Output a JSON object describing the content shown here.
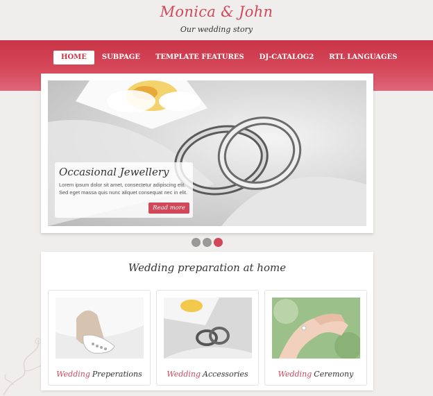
{
  "header": {
    "title": "Monica & John",
    "tagline": "Our wedding story"
  },
  "nav": {
    "items": [
      {
        "label": "HOME",
        "active": true
      },
      {
        "label": "SUBPAGE",
        "active": false
      },
      {
        "label": "TEMPLATE FEATURES",
        "active": false
      },
      {
        "label": "DJ-CATALOG2",
        "active": false
      },
      {
        "label": "RTL LANGUAGES",
        "active": false
      }
    ]
  },
  "slider": {
    "caption_title": "Occasional Jewellery",
    "caption_text": "Lorem ipsum dolor sit amet, consectetur adipiscing elit. Sed eget massa quis nunc aliquet consequat nec in elit.",
    "read_more": "Read more",
    "dots": [
      {
        "active": false
      },
      {
        "active": false
      },
      {
        "active": true
      }
    ]
  },
  "section": {
    "title": "Wedding preparation at home",
    "cards": [
      {
        "accent": "Wedding",
        "label": "Preperations",
        "icon": "shoe-image"
      },
      {
        "accent": "Wedding",
        "label": "Accessories",
        "icon": "rings-image"
      },
      {
        "accent": "Wedding",
        "label": "Ceremony",
        "icon": "hands-ring-image"
      }
    ]
  },
  "colors": {
    "accent": "#d0485a",
    "nav_band": "#c93446",
    "background": "#efeeec"
  }
}
